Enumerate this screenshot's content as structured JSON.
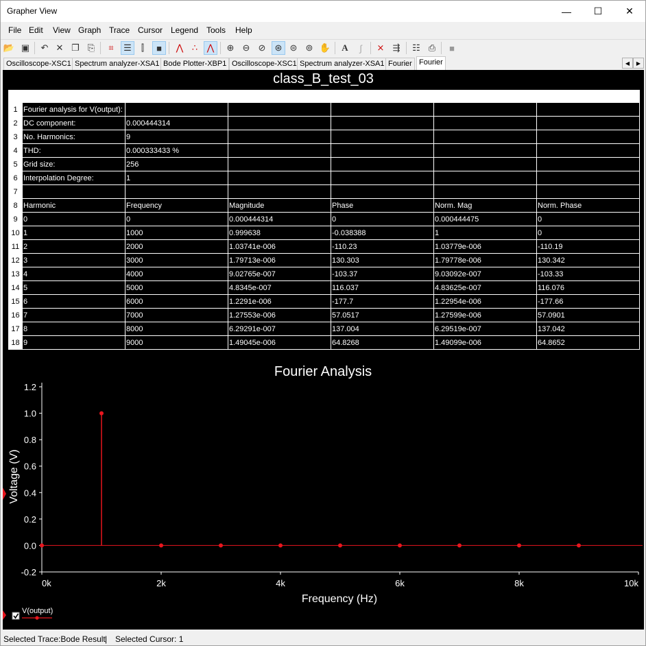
{
  "window": {
    "title": "Grapher View",
    "minimize_icon": "minimize-icon",
    "maximize_icon": "maximize-icon",
    "close_icon": "close-icon"
  },
  "menu": [
    "File",
    "Edit",
    "View",
    "Graph",
    "Trace",
    "Cursor",
    "Legend",
    "Tools",
    "Help"
  ],
  "toolbar": {
    "icons": [
      "open-icon",
      "save-icon",
      "undo-icon",
      "cut-icon",
      "copy-icon",
      "paste-icon",
      "grid-icon",
      "legend-icon",
      "cursors-icon",
      "reverse-colors-icon",
      "lines-icon",
      "points-icon",
      "lines-points-icon",
      "zoom-in-icon",
      "zoom-out-icon",
      "zoom-area-icon",
      "zoom-full-icon",
      "zoom-x-icon",
      "zoom-y-icon",
      "pan-icon",
      "text-icon",
      "symbol-icon",
      "overlay-traces-icon",
      "export-icon",
      "page-setup-icon",
      "print-icon",
      "stop-icon"
    ]
  },
  "tabs": [
    "Oscilloscope-XSC1",
    "Spectrum analyzer-XSA1",
    "Bode Plotter-XBP1",
    "Oscilloscope-XSC1",
    "Spectrum analyzer-XSA1",
    "Fourier",
    "Fourier"
  ],
  "active_tab_index": 6,
  "table": {
    "title": "class_B_test_03",
    "rows": [
      [
        "Fourier analysis for V(output):",
        "",
        "",
        "",
        "",
        ""
      ],
      [
        "DC component:",
        "0.000444314",
        "",
        "",
        "",
        ""
      ],
      [
        "No. Harmonics:",
        "9",
        "",
        "",
        "",
        ""
      ],
      [
        "THD:",
        "0.000333433 %",
        "",
        "",
        "",
        ""
      ],
      [
        "Grid size:",
        "256",
        "",
        "",
        "",
        ""
      ],
      [
        "Interpolation Degree:",
        "1",
        "",
        "",
        "",
        ""
      ],
      [
        "",
        "",
        "",
        "",
        "",
        ""
      ],
      [
        "Harmonic",
        "Frequency",
        "Magnitude",
        "Phase",
        "Norm. Mag",
        "Norm. Phase"
      ],
      [
        "0",
        "0",
        "0.000444314",
        "0",
        "0.000444475",
        "0"
      ],
      [
        "1",
        "1000",
        "0.999638",
        "-0.038388",
        "1",
        "0"
      ],
      [
        "2",
        "2000",
        "1.03741e-006",
        "-110.23",
        "1.03779e-006",
        "-110.19"
      ],
      [
        "3",
        "3000",
        "1.79713e-006",
        "130.303",
        "1.79778e-006",
        "130.342"
      ],
      [
        "4",
        "4000",
        "9.02765e-007",
        "-103.37",
        "9.03092e-007",
        "-103.33"
      ],
      [
        "5",
        "5000",
        "4.8345e-007",
        "116.037",
        "4.83625e-007",
        "116.076"
      ],
      [
        "6",
        "6000",
        "1.2291e-006",
        "-177.7",
        "1.22954e-006",
        "-177.66"
      ],
      [
        "7",
        "7000",
        "1.27553e-006",
        "57.0517",
        "1.27599e-006",
        "57.0901"
      ],
      [
        "8",
        "8000",
        "6.29291e-007",
        "137.004",
        "6.29519e-007",
        "137.042"
      ],
      [
        "9",
        "9000",
        "1.49045e-006",
        "64.8268",
        "1.49099e-006",
        "64.8652"
      ]
    ]
  },
  "chart_data": {
    "type": "scatter",
    "style": "stem",
    "title": "Fourier Analysis",
    "xlabel": "Frequency (Hz)",
    "ylabel": "Voltage (V)",
    "xlim": [
      0,
      10000
    ],
    "ylim": [
      -0.2,
      1.2
    ],
    "xticks": [
      0,
      2000,
      4000,
      6000,
      8000,
      10000
    ],
    "xtick_labels": [
      "0k",
      "2k",
      "4k",
      "6k",
      "8k",
      "10k"
    ],
    "yticks": [
      1.2,
      1.0,
      0.8,
      0.6,
      0.4,
      0.2,
      0.0,
      -0.2
    ],
    "ytick_labels": [
      "1.2",
      "1.0",
      "0.8",
      "0.6",
      "0.4",
      "0.2",
      "0.0",
      "-0.2"
    ],
    "grid": false,
    "background": "#000000",
    "series": [
      {
        "name": "V(output)",
        "color": "#e8161e",
        "x": [
          0,
          1000,
          2000,
          3000,
          4000,
          5000,
          6000,
          7000,
          8000,
          9000
        ],
        "y": [
          0.000444314,
          0.999638,
          1.03741e-06,
          1.79713e-06,
          9.02765e-07,
          4.8345e-07,
          1.2291e-06,
          1.27553e-06,
          6.29291e-07,
          1.49045e-06
        ]
      }
    ]
  },
  "legend": {
    "label": "V(output)",
    "checked": true
  },
  "status": {
    "trace": "Selected Trace:Bode Result",
    "separator": "|",
    "cursor": "Selected Cursor: 1"
  }
}
